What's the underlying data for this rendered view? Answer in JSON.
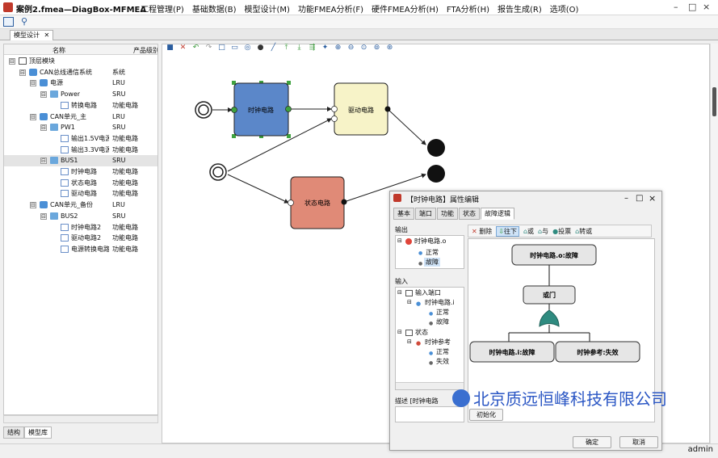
{
  "window": {
    "title": "案例2.fmea—DiagBox-MFMEA",
    "user": "admin"
  },
  "menu": [
    "工程管理(P)",
    "基础数据(B)",
    "模型设计(M)",
    "功能FMEA分析(F)",
    "硬件FMEA分析(H)",
    "FTA分析(H)",
    "报告生成(R)",
    "选项(O)"
  ],
  "window_controls": [
    "–",
    "□",
    "×"
  ],
  "main_tab": {
    "label": "模型设计",
    "close": "✕"
  },
  "tree": {
    "headers": [
      "名称",
      "产品级别"
    ],
    "rows": [
      {
        "label": "顶层模块",
        "type": "",
        "indent": 0,
        "icon": "module-icon",
        "exp": "⊟"
      },
      {
        "label": "CAN总线通信系统",
        "type": "系统",
        "indent": 1,
        "icon": "cube-icon",
        "exp": "⊟"
      },
      {
        "label": "电源",
        "type": "LRU",
        "indent": 2,
        "icon": "cube-icon",
        "exp": "⊟"
      },
      {
        "label": "Power",
        "type": "SRU",
        "indent": 3,
        "icon": "folder-icon",
        "exp": "⊟"
      },
      {
        "label": "转换电路",
        "type": "功能电路",
        "indent": 4,
        "icon": "doc-icon",
        "exp": ""
      },
      {
        "label": "CAN单元_主",
        "type": "LRU",
        "indent": 2,
        "icon": "cube-icon",
        "exp": "⊟"
      },
      {
        "label": "PW1",
        "type": "SRU",
        "indent": 3,
        "icon": "folder-icon",
        "exp": "⊟"
      },
      {
        "label": "输出1.5V电源",
        "type": "功能电路",
        "indent": 4,
        "icon": "doc-icon",
        "exp": ""
      },
      {
        "label": "输出3.3V电源",
        "type": "功能电路",
        "indent": 4,
        "icon": "doc-icon",
        "exp": ""
      },
      {
        "label": "BUS1",
        "type": "SRU",
        "indent": 3,
        "icon": "folder-icon",
        "exp": "⊟",
        "selected": true
      },
      {
        "label": "时钟电路",
        "type": "功能电路",
        "indent": 4,
        "icon": "doc-icon",
        "exp": ""
      },
      {
        "label": "状态电路",
        "type": "功能电路",
        "indent": 4,
        "icon": "doc-icon",
        "exp": ""
      },
      {
        "label": "驱动电路",
        "type": "功能电路",
        "indent": 4,
        "icon": "doc-icon",
        "exp": ""
      },
      {
        "label": "CAN单元_备份",
        "type": "LRU",
        "indent": 2,
        "icon": "cube-icon",
        "exp": "⊟"
      },
      {
        "label": "BUS2",
        "type": "SRU",
        "indent": 3,
        "icon": "folder-icon",
        "exp": "⊟"
      },
      {
        "label": "时钟电路2",
        "type": "功能电路",
        "indent": 4,
        "icon": "doc-icon",
        "exp": ""
      },
      {
        "label": "驱动电路2",
        "type": "功能电路",
        "indent": 4,
        "icon": "doc-icon",
        "exp": ""
      },
      {
        "label": "电源转换电路",
        "type": "功能电路",
        "indent": 4,
        "icon": "doc-icon",
        "exp": ""
      }
    ]
  },
  "bottom_tabs": [
    "结构",
    "模型库"
  ],
  "diagram": {
    "blocks": [
      {
        "label": "时钟电路",
        "color": "#5b87c9"
      },
      {
        "label": "驱动电路",
        "color": "#f7f3c8"
      },
      {
        "label": "状态电路",
        "color": "#e08a77"
      }
    ]
  },
  "dialog": {
    "title": "【时钟电路】属性编辑",
    "tabs": [
      "基本",
      "端口",
      "功能",
      "状态",
      "故障逻辑"
    ],
    "active_tab": "故障逻辑",
    "output_group": "输出",
    "output_items": [
      "时钟电路.o",
      "正常",
      "故障"
    ],
    "input_group": "输入",
    "input_items": [
      "输入端口",
      "时钟电路.i",
      "正常",
      "故障",
      "状态",
      "时钟参考",
      "正常",
      "失效"
    ],
    "desc_label": "描述 [时钟电路",
    "toolbar": [
      "删除",
      "往下",
      "或",
      "与",
      "投票",
      "转或"
    ],
    "fault_tree": {
      "top_event": "时钟电路.o:故障",
      "gate": "或门",
      "children": [
        "时钟电路.i:故障",
        "时钟参考:失效"
      ]
    },
    "init_button": "初始化",
    "ok_button": "确定",
    "cancel_button": "取消"
  },
  "watermark": "北京质远恒峰科技有限公司"
}
